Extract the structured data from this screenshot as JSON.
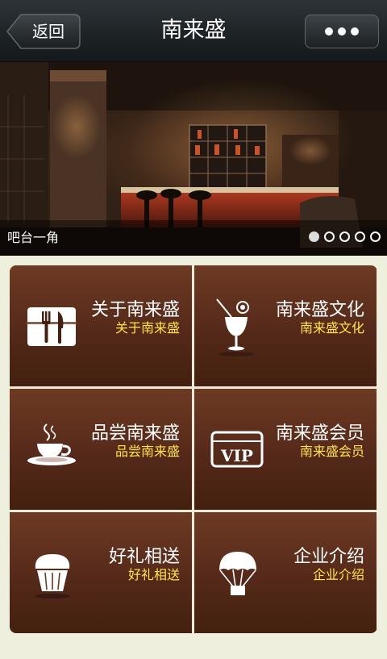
{
  "header": {
    "back_label": "返回",
    "title": "南来盛"
  },
  "banner": {
    "caption": "吧台一角",
    "slide_count": 5,
    "active_slide": 1
  },
  "menu": {
    "items": [
      {
        "title": "关于南来盛",
        "subtitle": "关于南来盛",
        "icon": "cutlery-icon"
      },
      {
        "title": "南来盛文化",
        "subtitle": "南来盛文化",
        "icon": "cocktail-icon"
      },
      {
        "title": "品尝南来盛",
        "subtitle": "品尝南来盛",
        "icon": "coffee-cup-icon"
      },
      {
        "title": "南来盛会员",
        "subtitle": "南来盛会员",
        "icon": "vip-card-icon"
      },
      {
        "title": "好礼相送",
        "subtitle": "好礼相送",
        "icon": "cupcake-icon"
      },
      {
        "title": "企业介绍",
        "subtitle": "企业介绍",
        "icon": "parachute-icon"
      }
    ],
    "title_color": "#ffffff",
    "subtitle_color": "#ffe54b",
    "tile_color": "#5a2b1a"
  },
  "vip_text": "VIP"
}
